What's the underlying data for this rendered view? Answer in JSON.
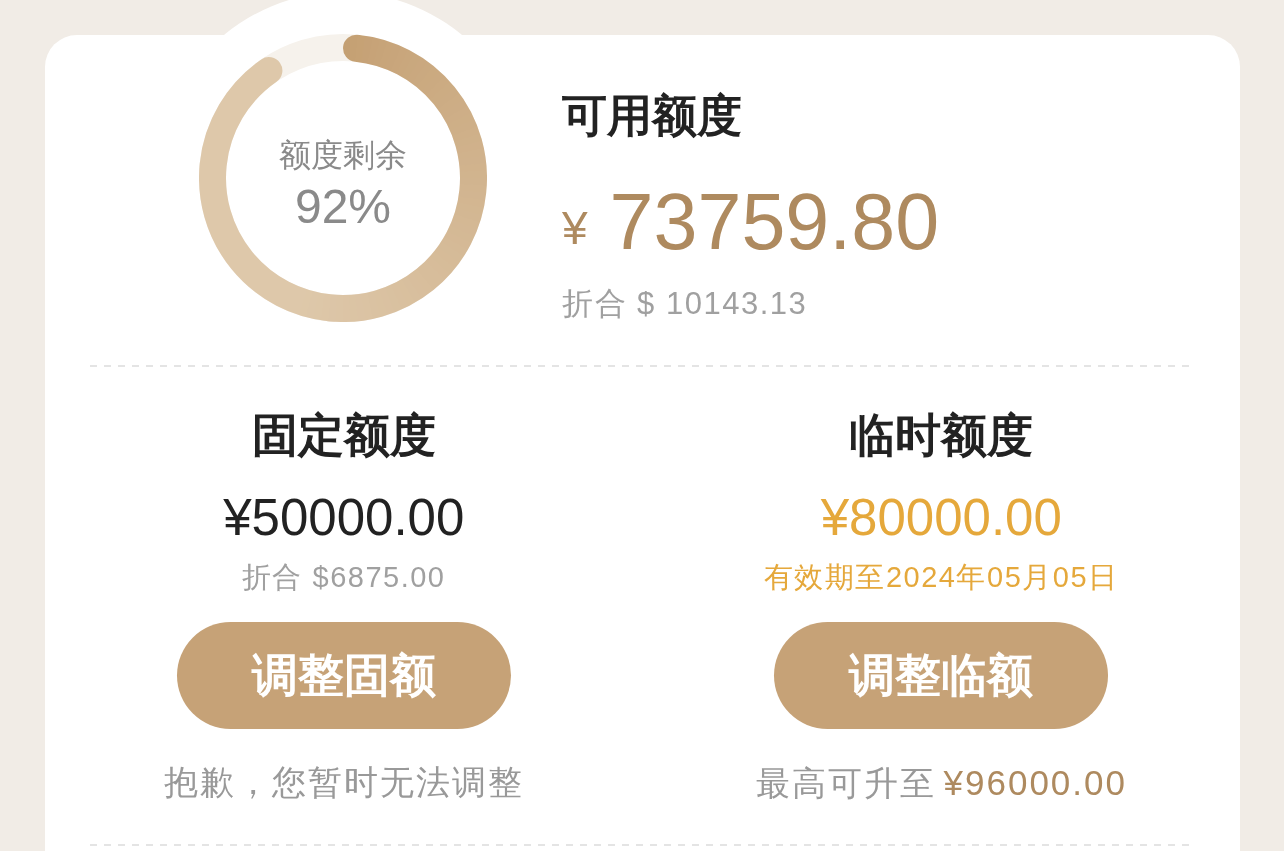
{
  "quota_ring": {
    "label": "额度剩余",
    "percent_text": "92%",
    "level": 0.92
  },
  "available": {
    "title": "可用额度",
    "currency": "¥",
    "amount": "73759.80",
    "converted": "折合 $ 10143.13"
  },
  "quota_columns": [
    {
      "kind": "fixed",
      "title": "固定额度",
      "amount": "¥50000.00",
      "subtext": "折合 $6875.00",
      "button": "调整固额",
      "note": "抱歉，您暂时无法调整"
    },
    {
      "kind": "temporary",
      "title": "临时额度",
      "amount": "¥80000.00",
      "subtext": "有效期至2024年05月05日",
      "button": "调整临额",
      "note": "最高可升至",
      "note_amount": "¥96000.00"
    }
  ]
}
